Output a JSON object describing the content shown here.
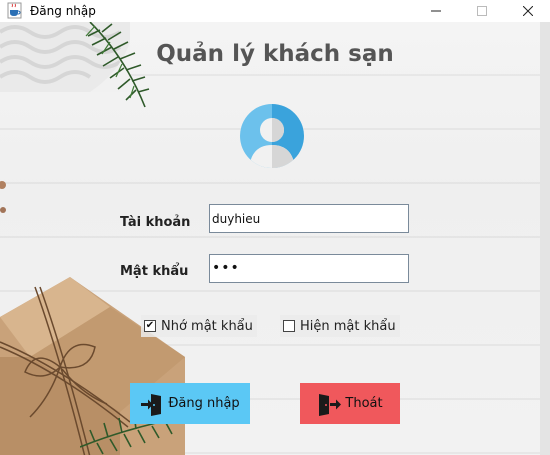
{
  "window": {
    "title": "Đăng nhập",
    "controls": {
      "minimize": "—",
      "maximize": "☐",
      "close": "✕"
    }
  },
  "header": {
    "title": "Quản lý khách sạn"
  },
  "form": {
    "username_label": "Tài khoản",
    "username_value": "duyhieu",
    "password_label": "Mật khẩu",
    "password_value": "•••",
    "remember": {
      "label": "Nhớ mật khẩu",
      "checked": true,
      "mark": "✔"
    },
    "show_password": {
      "label": "Hiện mật khẩu",
      "checked": false,
      "mark": ""
    }
  },
  "buttons": {
    "login_label": "Đăng nhập",
    "exit_label": "Thoát"
  },
  "colors": {
    "login_button": "#5bc8f5",
    "exit_button": "#f0585c",
    "title_text": "#555555",
    "avatar": "#3aa3dc"
  },
  "icons": {
    "app": "java-cup-icon",
    "avatar": "user-avatar-icon",
    "login": "door-enter-icon",
    "exit": "door-exit-icon"
  }
}
